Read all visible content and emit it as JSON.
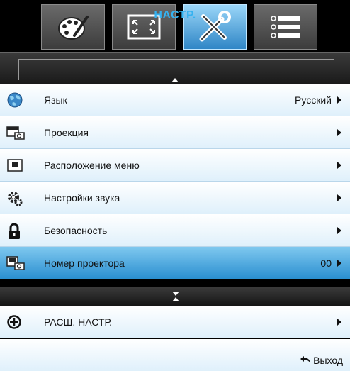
{
  "tabs": [
    {
      "icon": "palette-icon",
      "active": false
    },
    {
      "icon": "screen-fit-icon",
      "active": false
    },
    {
      "icon": "tools-icon",
      "active": true
    },
    {
      "icon": "list-menu-icon",
      "active": false
    }
  ],
  "header": {
    "title": "НАСТР."
  },
  "menu": {
    "items": [
      {
        "icon": "globe-icon",
        "label": "Язык",
        "value": "Русский",
        "selected": false
      },
      {
        "icon": "projection-icon",
        "label": "Проекция",
        "value": "",
        "selected": false
      },
      {
        "icon": "menu-location-icon",
        "label": "Расположение меню",
        "value": "",
        "selected": false
      },
      {
        "icon": "audio-settings-icon",
        "label": "Настройки звука",
        "value": "",
        "selected": false
      },
      {
        "icon": "lock-icon",
        "label": "Безопасность",
        "value": "",
        "selected": false
      },
      {
        "icon": "projector-id-icon",
        "label": "Номер проектора",
        "value": "00",
        "selected": true
      }
    ]
  },
  "advanced": {
    "icon": "plus-circle-icon",
    "label": "РАСШ. НАСТР."
  },
  "footer": {
    "exit_label": "Выход",
    "exit_icon": "return-arrow-icon"
  },
  "colors": {
    "accent": "#35b2f0",
    "selected_row": "#2a8fd0",
    "tab_active": "#4aa6de"
  }
}
